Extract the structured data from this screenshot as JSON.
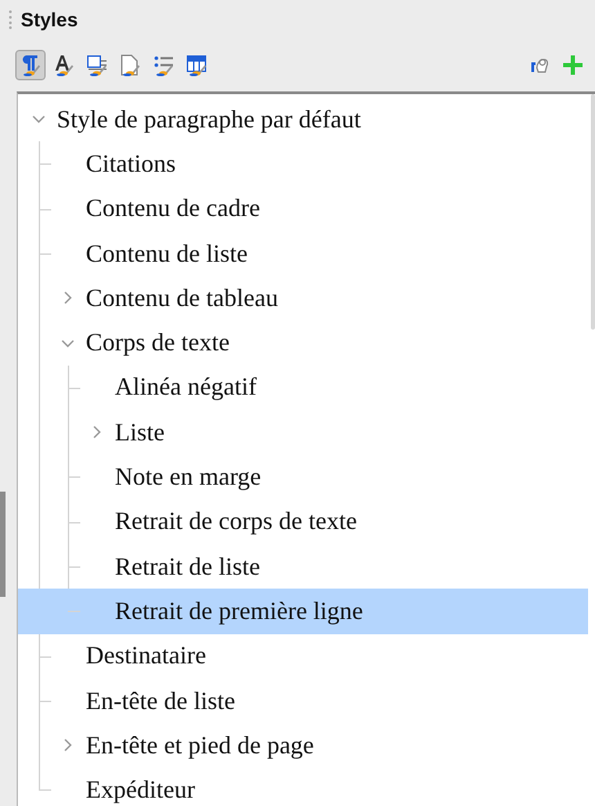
{
  "panel": {
    "title": "Styles"
  },
  "style_families": [
    {
      "selected": true
    },
    {
      "selected": false
    },
    {
      "selected": false
    },
    {
      "selected": false
    },
    {
      "selected": false
    },
    {
      "selected": false
    }
  ],
  "tree": [
    {
      "label": "Style de paragraphe par défaut",
      "expanded": true,
      "selected": false,
      "children": [
        {
          "label": "Citations",
          "selected": false
        },
        {
          "label": "Contenu de cadre",
          "selected": false
        },
        {
          "label": "Contenu de liste",
          "selected": false
        },
        {
          "label": "Contenu de tableau",
          "expanded": false,
          "selected": false
        },
        {
          "label": "Corps de texte",
          "expanded": true,
          "selected": false,
          "children": [
            {
              "label": "Alinéa négatif",
              "selected": false
            },
            {
              "label": "Liste",
              "expanded": false,
              "selected": false
            },
            {
              "label": "Note en marge",
              "selected": false
            },
            {
              "label": "Retrait de corps de texte",
              "selected": false
            },
            {
              "label": "Retrait de liste",
              "selected": false
            },
            {
              "label": "Retrait de première ligne",
              "selected": true
            }
          ]
        },
        {
          "label": "Destinataire",
          "selected": false
        },
        {
          "label": "En-tête de liste",
          "selected": false
        },
        {
          "label": "En-tête et pied de page",
          "expanded": false,
          "selected": false
        },
        {
          "label": "Expéditeur",
          "selected": false
        }
      ]
    }
  ]
}
